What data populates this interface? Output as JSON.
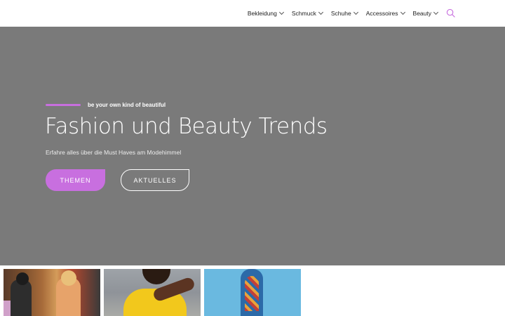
{
  "nav": {
    "items": [
      {
        "label": "Bekleidung"
      },
      {
        "label": "Schmuck"
      },
      {
        "label": "Schuhe"
      },
      {
        "label": "Accessoires"
      },
      {
        "label": "Beauty"
      }
    ],
    "search_icon": "search-icon",
    "accent_color": "#c86fdf"
  },
  "hero": {
    "tagline": "be your own kind of beautiful",
    "title": "Fashion und Beauty Trends",
    "subtitle": "Erfahre alles über die Must Haves am Modehimmel",
    "buttons": {
      "primary": "THEMEN",
      "secondary": "AKTUELLES"
    },
    "background_color": "#7a7a7a"
  }
}
